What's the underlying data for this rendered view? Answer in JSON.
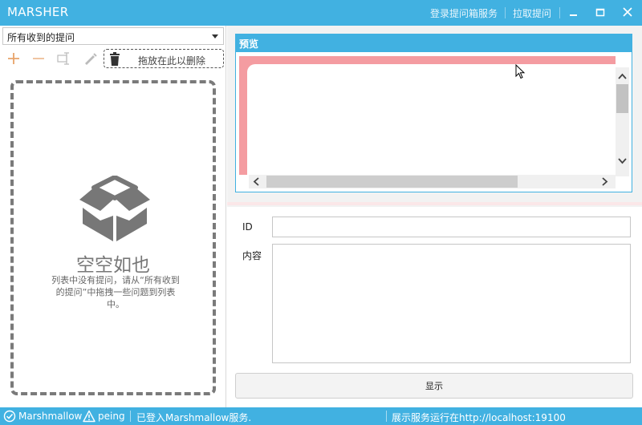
{
  "window": {
    "title": "MARSHER",
    "links": {
      "login": "登录提问箱服务",
      "fetch": "拉取提问"
    },
    "buttons": [
      "minimize-icon",
      "maximize-icon",
      "close-icon"
    ]
  },
  "left_panel": {
    "filter": {
      "selected": "所有收到的提问"
    },
    "toolbar": {
      "icons": [
        "plus-icon",
        "minus-icon",
        "rename-icon",
        "edit-icon",
        "trash-icon"
      ],
      "drop_delete_label": "拖放在此以删除"
    },
    "empty": {
      "title": "空空如也",
      "description": "列表中没有提问，请从“所有收到的提问”中拖拽一些问题到列表中。"
    }
  },
  "preview": {
    "header": "预览"
  },
  "form": {
    "id_label": "ID",
    "id_value": "",
    "content_label": "内容",
    "content_value": "",
    "show_button": "显示"
  },
  "status": {
    "marshmallow": "Marshmallow",
    "peing": "peing",
    "login_status": "已登入Marshmallow服务.",
    "server_status": "展示服务运行在http://localhost:19100"
  },
  "colors": {
    "accent": "#41b1e1",
    "preview_frame": "#f49ca1",
    "toolbar_icon": "#e8a36a"
  }
}
